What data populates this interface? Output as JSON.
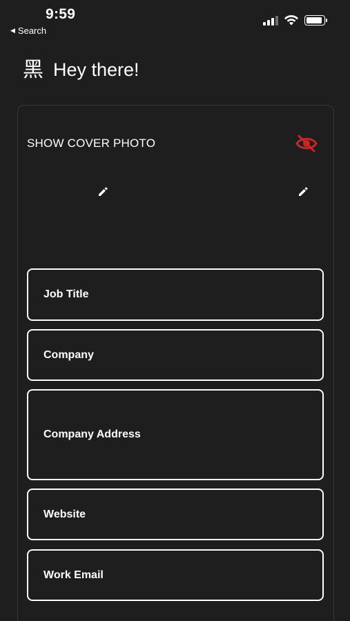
{
  "status_bar": {
    "time": "9:59",
    "back_label": "Search",
    "back_arrow": "◀",
    "icons": [
      "cellular-signal-icon",
      "wifi-icon",
      "battery-icon"
    ],
    "battery_level": 0.9
  },
  "header": {
    "logo_glyph": "黑",
    "title": "Hey there!"
  },
  "cover": {
    "label": "SHOW COVER PHOTO",
    "visibility_icon": "eye-off-icon",
    "visibility_color": "#c62828",
    "edit_icon": "pencil-icon"
  },
  "fields": {
    "job_title": "Job Title",
    "company": "Company",
    "company_address": "Company Address",
    "website": "Website",
    "work_email": "Work Email"
  },
  "colors": {
    "background": "#1e1e1e",
    "card_border": "#3a3a3a",
    "text": "#ffffff",
    "accent_red": "#c62828"
  }
}
